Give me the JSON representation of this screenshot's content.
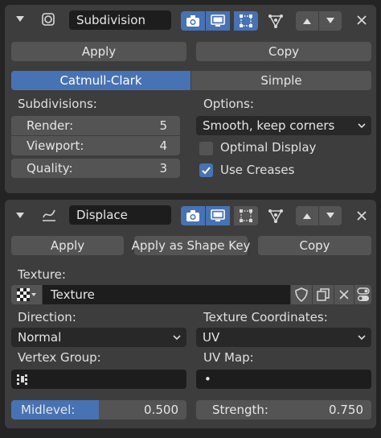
{
  "subdivision": {
    "name": "Subdivision",
    "apply": "Apply",
    "copy": "Copy",
    "tabs": [
      "Catmull-Clark",
      "Simple"
    ],
    "subdivisions_label": "Subdivisions:",
    "options_label": "Options:",
    "render_label": "Render:",
    "render_value": "5",
    "viewport_label": "Viewport:",
    "viewport_value": "4",
    "quality_label": "Quality:",
    "quality_value": "3",
    "uv_smooth": "Smooth, keep corners",
    "optimal_display": "Optimal Display",
    "optimal_display_checked": false,
    "use_creases": "Use Creases",
    "use_creases_checked": true
  },
  "displace": {
    "name": "Displace",
    "apply": "Apply",
    "apply_shape_key": "Apply as Shape Key",
    "copy": "Copy",
    "texture_label": "Texture:",
    "texture_name": "Texture",
    "direction_label": "Direction:",
    "direction_value": "Normal",
    "texcoords_label": "Texture Coordinates:",
    "texcoords_value": "UV",
    "vertex_group_label": "Vertex Group:",
    "vertex_group_value": "",
    "uv_map_label": "UV Map:",
    "uv_map_value": "•",
    "midlevel_label": "Midlevel:",
    "midlevel_value": "0.500",
    "midlevel_fraction": 0.5,
    "strength_label": "Strength:",
    "strength_value": "0.750"
  },
  "colors": {
    "accent": "#4772b3",
    "panel": "#3d3d3d",
    "button": "#545454",
    "field": "#1d1d1d"
  }
}
